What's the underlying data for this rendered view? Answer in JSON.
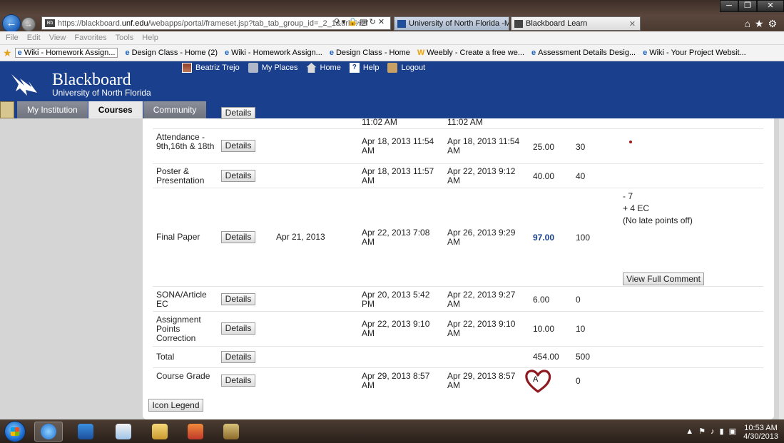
{
  "browser": {
    "url_prefix": "https://blackboard.",
    "url_domain": "unf.edu",
    "url_rest": "/webapps/portal/frameset.jsp?tab_tab_group_id=_2_1&url=%2f",
    "tabs": [
      {
        "label": "University of North Florida -M..."
      },
      {
        "label": "Blackboard Learn"
      }
    ],
    "menu": [
      "File",
      "Edit",
      "View",
      "Favorites",
      "Tools",
      "Help"
    ],
    "favorites": [
      "Wiki - Homework Assign...",
      "Design Class - Home (2)",
      "Wiki - Homework Assign...",
      "Design Class - Home",
      "Weebly - Create a free we...",
      "Assessment Details Desig...",
      "Wiki - Your Project Websit..."
    ]
  },
  "header": {
    "title": "Blackboard",
    "subtitle": "University of North Florida",
    "user": "Beatriz Trejo",
    "links": [
      "My Places",
      "Home",
      "Help",
      "Logout"
    ],
    "tabs": [
      "My Institution",
      "Courses",
      "Community"
    ]
  },
  "grades": {
    "details_label": "Details",
    "top_partial": {
      "created": "11:02 AM",
      "modified": "11:02 AM"
    },
    "rows": [
      {
        "name": "Attendance - 9th,16th & 18th",
        "due": "",
        "created": "Apr 18, 2013 11:54 AM",
        "modified": "Apr 18, 2013 11:54 AM",
        "grade": "25.00",
        "possible": "30"
      },
      {
        "name": "Poster & Presentation",
        "due": "",
        "created": "Apr 18, 2013 11:57 AM",
        "modified": "Apr 22, 2013 9:12 AM",
        "grade": "40.00",
        "possible": "40"
      },
      {
        "name": "Final Paper",
        "due": "Apr 21, 2013",
        "created": "Apr 22, 2013 7:08 AM",
        "modified": "Apr 26, 2013 9:29 AM",
        "grade": "97.00",
        "possible": "100"
      },
      {
        "name": "SONA/Article EC",
        "due": "",
        "created": "Apr 20, 2013 5:42 PM",
        "modified": "Apr 22, 2013 9:27 AM",
        "grade": "6.00",
        "possible": "0"
      },
      {
        "name": "Assignment Points Correction",
        "due": "",
        "created": "Apr 22, 2013 9:10 AM",
        "modified": "Apr 22, 2013 9:10 AM",
        "grade": "10.00",
        "possible": "10"
      },
      {
        "name": "Total",
        "due": "",
        "created": "",
        "modified": "",
        "grade": "454.00",
        "possible": "500"
      },
      {
        "name": "Course Grade",
        "due": "",
        "created": "Apr 29, 2013 8:57 AM",
        "modified": "Apr 29, 2013 8:57 AM",
        "grade": "A",
        "possible": "0"
      }
    ],
    "final_paper_comment": [
      "- 7",
      "+ 4 EC",
      "(No late points off)"
    ],
    "view_full_comment": "View Full Comment",
    "icon_legend": "Icon Legend"
  },
  "colors": {
    "bb_blue": "#1a3f8c",
    "heart": "#8e1b22"
  },
  "taskbar": {
    "time": "10:53 AM",
    "date": "4/30/2013"
  }
}
